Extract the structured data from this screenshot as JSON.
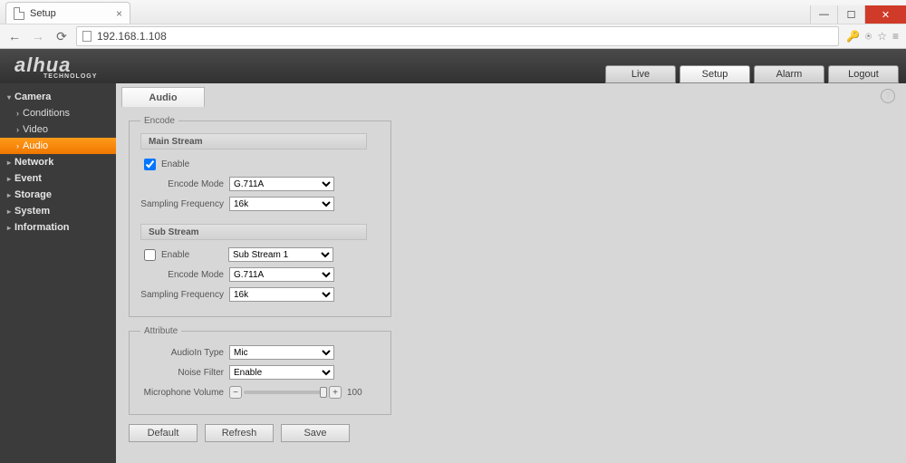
{
  "browser": {
    "tab_title": "Setup",
    "url": "192.168.1.108"
  },
  "brand": {
    "name": "alhua",
    "subtitle": "TECHNOLOGY"
  },
  "header_tabs": {
    "live": "Live",
    "setup": "Setup",
    "alarm": "Alarm",
    "logout": "Logout"
  },
  "sidebar": {
    "camera": "Camera",
    "items": {
      "conditions": "Conditions",
      "video": "Video",
      "audio": "Audio"
    },
    "network": "Network",
    "event": "Event",
    "storage": "Storage",
    "system": "System",
    "information": "Information"
  },
  "content_tab": "Audio",
  "encode": {
    "legend": "Encode",
    "main_header": "Main Stream",
    "main_enable_label": "Enable",
    "main_encode_label": "Encode Mode",
    "main_encode_value": "G.711A",
    "main_freq_label": "Sampling Frequency",
    "main_freq_value": "16k",
    "sub_header": "Sub Stream",
    "sub_enable_label": "Enable",
    "sub_stream_value": "Sub Stream 1",
    "sub_encode_label": "Encode Mode",
    "sub_encode_value": "G.711A",
    "sub_freq_label": "Sampling Frequency",
    "sub_freq_value": "16k"
  },
  "attribute": {
    "legend": "Attribute",
    "audioin_label": "AudioIn Type",
    "audioin_value": "Mic",
    "noise_label": "Noise Filter",
    "noise_value": "Enable",
    "micvol_label": "Microphone Volume",
    "micvol_value": "100"
  },
  "buttons": {
    "default": "Default",
    "refresh": "Refresh",
    "save": "Save"
  }
}
